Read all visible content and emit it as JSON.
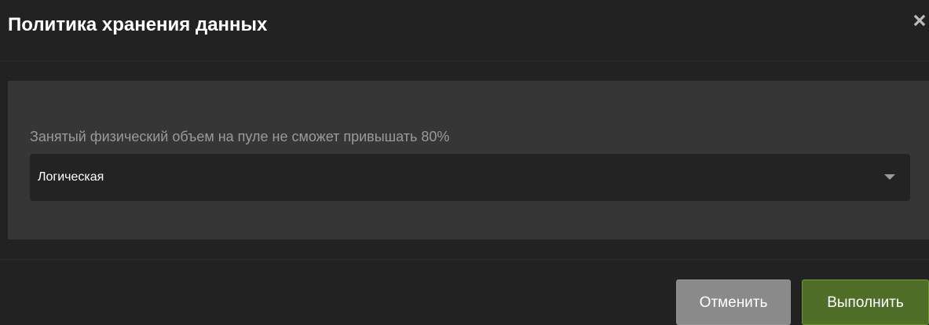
{
  "dialog": {
    "title": "Политика хранения данных",
    "close_icon": "close-icon"
  },
  "form": {
    "hint": "Занятый физический объем на пуле не сможет привышать 80%",
    "select": {
      "value": "Логическая",
      "caret_icon": "caret-down-icon"
    }
  },
  "footer": {
    "cancel_label": "Отменить",
    "submit_label": "Выполнить"
  },
  "colors": {
    "background": "#222222",
    "panel": "#363636",
    "input_bg": "#232323",
    "cancel_button": "#8a8a8a",
    "submit_button": "#4f6f29"
  }
}
